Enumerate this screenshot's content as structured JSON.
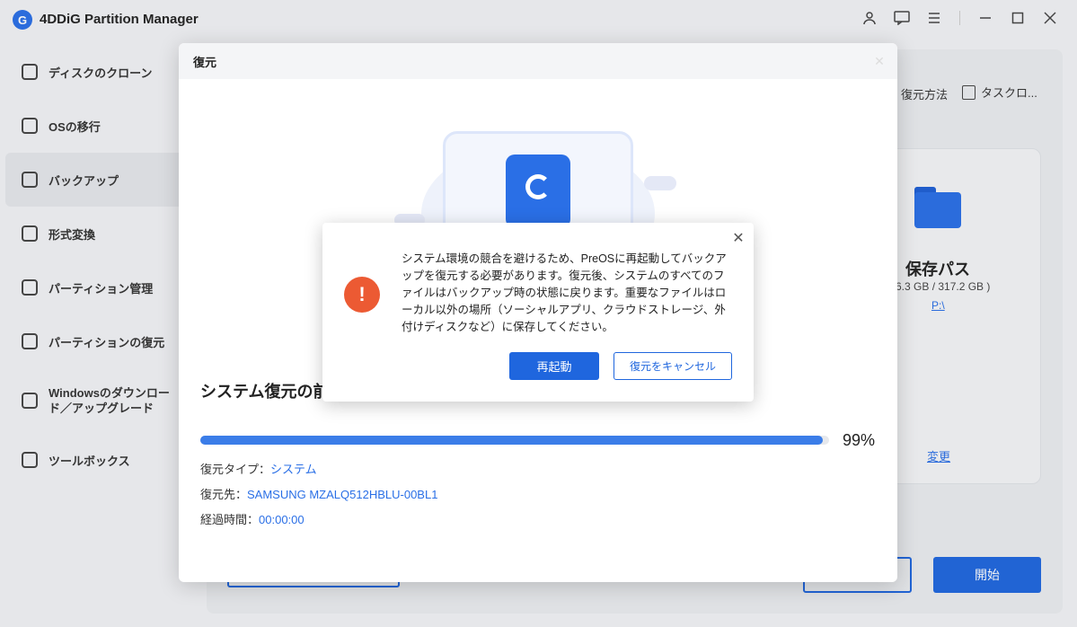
{
  "app": {
    "title": "4DDiG Partition Manager",
    "logo_glyph": "G"
  },
  "window_icons": [
    "user-icon",
    "feedback-icon",
    "menu-icon",
    "minimize-icon",
    "maximize-icon",
    "close-icon"
  ],
  "sidebar": {
    "items": [
      {
        "label": "ディスクのクローン",
        "icon": "disk-clone-icon"
      },
      {
        "label": "OSの移行",
        "icon": "os-migrate-icon"
      },
      {
        "label": "バックアップ",
        "icon": "backup-icon",
        "active": true
      },
      {
        "label": "形式変換",
        "icon": "convert-icon"
      },
      {
        "label": "パーティション管理",
        "icon": "partition-icon"
      },
      {
        "label": "パーティションの復元",
        "icon": "partition-restore-icon"
      },
      {
        "label": "Windowsのダウンロード／アップグレード",
        "icon": "windows-download-icon"
      },
      {
        "label": "ツールボックス",
        "icon": "toolbox-icon"
      }
    ]
  },
  "background": {
    "option1": "復元方法",
    "option2": "タスクロ...",
    "save_title": "保存パス",
    "save_size": "6.3 GB / 317.2 GB )",
    "save_path": "P:\\",
    "change_link": "変更",
    "start_button": "開始"
  },
  "restore_modal": {
    "title": "復元",
    "heading": "システム復元の前",
    "progress_percent": 99,
    "progress_label": "99%",
    "restore_type_label": "復元タイプ：",
    "restore_type_value": "システム",
    "target_label": "復元先：",
    "target_value": "SAMSUNG MZALQ512HBLU-00BL1",
    "elapsed_label": "経過時間：",
    "elapsed_value": "00:00:00"
  },
  "alert": {
    "icon": "warning-icon",
    "message": "システム環境の競合を避けるため、PreOSに再起動してバックアップを復元する必要があります。復元後、システムのすべてのファイルはバックアップ時の状態に戻ります。重要なファイルはローカル以外の場所（ソーシャルアプリ、クラウドストレージ、外付けディスクなど）に保存してください。",
    "primary_button": "再起動",
    "secondary_button": "復元をキャンセル"
  },
  "colors": {
    "accent": "#1f66de",
    "warning": "#ec5a33",
    "progress": "#3b7de8"
  }
}
